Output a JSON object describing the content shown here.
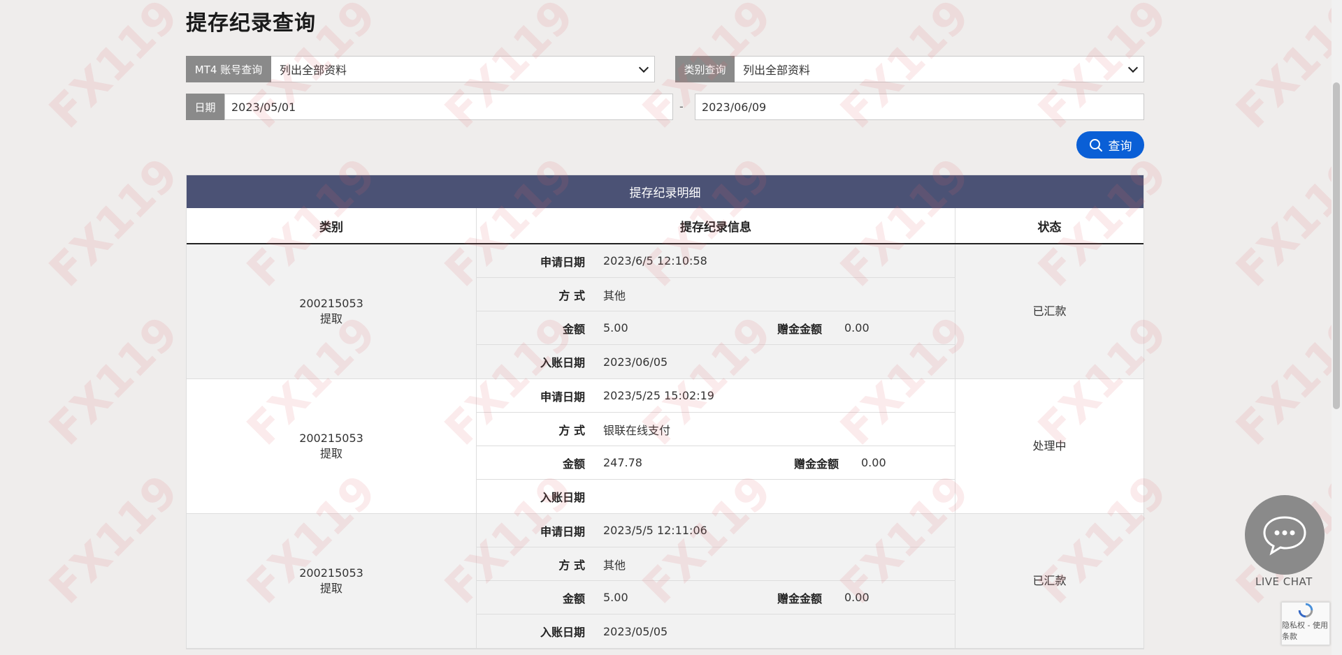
{
  "page_title": "提存纪录查询",
  "filters": {
    "account_label": "MT4 账号查询",
    "account_value": "列出全部资料",
    "type_label": "类别查询",
    "type_value": "列出全部资料",
    "date_label": "日期",
    "date_from": "2023/05/01",
    "date_separator": "-",
    "date_to": "2023/06/09"
  },
  "search_button": "查询",
  "table": {
    "heading": "提存纪录明细",
    "columns": [
      "类别",
      "提存纪录信息",
      "状态"
    ],
    "field_labels": {
      "apply_date": "申请日期",
      "method": "方 式",
      "amount": "金额",
      "bonus": "赠金金额",
      "credit_date": "入账日期"
    },
    "records": [
      {
        "account": "200215053",
        "kind": "提取",
        "apply_date": "2023/6/5 12:10:58",
        "method": "其他",
        "amount": "5.00",
        "bonus": "0.00",
        "credit_date": "2023/06/05",
        "status": "已汇款"
      },
      {
        "account": "200215053",
        "kind": "提取",
        "apply_date": "2023/5/25 15:02:19",
        "method": "银联在线支付",
        "amount": "247.78",
        "bonus": "0.00",
        "credit_date": "",
        "status": "处理中"
      },
      {
        "account": "200215053",
        "kind": "提取",
        "apply_date": "2023/5/5 12:11:06",
        "method": "其他",
        "amount": "5.00",
        "bonus": "0.00",
        "credit_date": "2023/05/05",
        "status": "已汇款"
      }
    ]
  },
  "watermark": "FX119",
  "live_chat_label": "LIVE CHAT",
  "recaptcha_text": "隐私权 - 使用条款",
  "colors": {
    "table_header": "#4b5275",
    "search_button": "#0a5fd6",
    "filter_label": "#8a8a8a",
    "background": "#efedec"
  }
}
